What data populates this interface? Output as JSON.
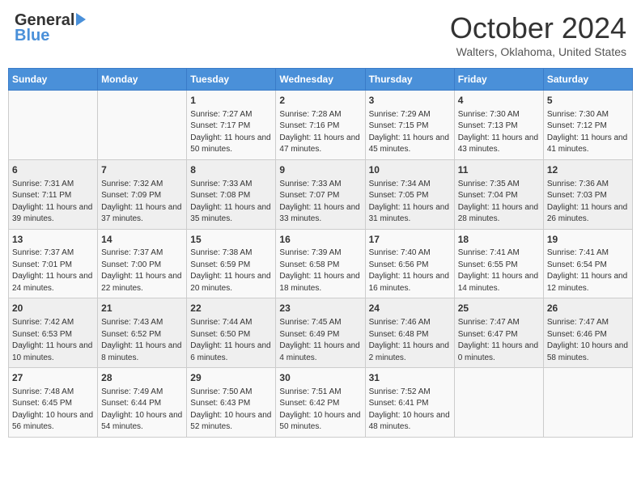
{
  "header": {
    "logo_general": "General",
    "logo_blue": "Blue",
    "month": "October 2024",
    "location": "Walters, Oklahoma, United States"
  },
  "days_of_week": [
    "Sunday",
    "Monday",
    "Tuesday",
    "Wednesday",
    "Thursday",
    "Friday",
    "Saturday"
  ],
  "weeks": [
    [
      {
        "day": "",
        "sunrise": "",
        "sunset": "",
        "daylight": ""
      },
      {
        "day": "",
        "sunrise": "",
        "sunset": "",
        "daylight": ""
      },
      {
        "day": "1",
        "sunrise": "Sunrise: 7:27 AM",
        "sunset": "Sunset: 7:17 PM",
        "daylight": "Daylight: 11 hours and 50 minutes."
      },
      {
        "day": "2",
        "sunrise": "Sunrise: 7:28 AM",
        "sunset": "Sunset: 7:16 PM",
        "daylight": "Daylight: 11 hours and 47 minutes."
      },
      {
        "day": "3",
        "sunrise": "Sunrise: 7:29 AM",
        "sunset": "Sunset: 7:15 PM",
        "daylight": "Daylight: 11 hours and 45 minutes."
      },
      {
        "day": "4",
        "sunrise": "Sunrise: 7:30 AM",
        "sunset": "Sunset: 7:13 PM",
        "daylight": "Daylight: 11 hours and 43 minutes."
      },
      {
        "day": "5",
        "sunrise": "Sunrise: 7:30 AM",
        "sunset": "Sunset: 7:12 PM",
        "daylight": "Daylight: 11 hours and 41 minutes."
      }
    ],
    [
      {
        "day": "6",
        "sunrise": "Sunrise: 7:31 AM",
        "sunset": "Sunset: 7:11 PM",
        "daylight": "Daylight: 11 hours and 39 minutes."
      },
      {
        "day": "7",
        "sunrise": "Sunrise: 7:32 AM",
        "sunset": "Sunset: 7:09 PM",
        "daylight": "Daylight: 11 hours and 37 minutes."
      },
      {
        "day": "8",
        "sunrise": "Sunrise: 7:33 AM",
        "sunset": "Sunset: 7:08 PM",
        "daylight": "Daylight: 11 hours and 35 minutes."
      },
      {
        "day": "9",
        "sunrise": "Sunrise: 7:33 AM",
        "sunset": "Sunset: 7:07 PM",
        "daylight": "Daylight: 11 hours and 33 minutes."
      },
      {
        "day": "10",
        "sunrise": "Sunrise: 7:34 AM",
        "sunset": "Sunset: 7:05 PM",
        "daylight": "Daylight: 11 hours and 31 minutes."
      },
      {
        "day": "11",
        "sunrise": "Sunrise: 7:35 AM",
        "sunset": "Sunset: 7:04 PM",
        "daylight": "Daylight: 11 hours and 28 minutes."
      },
      {
        "day": "12",
        "sunrise": "Sunrise: 7:36 AM",
        "sunset": "Sunset: 7:03 PM",
        "daylight": "Daylight: 11 hours and 26 minutes."
      }
    ],
    [
      {
        "day": "13",
        "sunrise": "Sunrise: 7:37 AM",
        "sunset": "Sunset: 7:01 PM",
        "daylight": "Daylight: 11 hours and 24 minutes."
      },
      {
        "day": "14",
        "sunrise": "Sunrise: 7:37 AM",
        "sunset": "Sunset: 7:00 PM",
        "daylight": "Daylight: 11 hours and 22 minutes."
      },
      {
        "day": "15",
        "sunrise": "Sunrise: 7:38 AM",
        "sunset": "Sunset: 6:59 PM",
        "daylight": "Daylight: 11 hours and 20 minutes."
      },
      {
        "day": "16",
        "sunrise": "Sunrise: 7:39 AM",
        "sunset": "Sunset: 6:58 PM",
        "daylight": "Daylight: 11 hours and 18 minutes."
      },
      {
        "day": "17",
        "sunrise": "Sunrise: 7:40 AM",
        "sunset": "Sunset: 6:56 PM",
        "daylight": "Daylight: 11 hours and 16 minutes."
      },
      {
        "day": "18",
        "sunrise": "Sunrise: 7:41 AM",
        "sunset": "Sunset: 6:55 PM",
        "daylight": "Daylight: 11 hours and 14 minutes."
      },
      {
        "day": "19",
        "sunrise": "Sunrise: 7:41 AM",
        "sunset": "Sunset: 6:54 PM",
        "daylight": "Daylight: 11 hours and 12 minutes."
      }
    ],
    [
      {
        "day": "20",
        "sunrise": "Sunrise: 7:42 AM",
        "sunset": "Sunset: 6:53 PM",
        "daylight": "Daylight: 11 hours and 10 minutes."
      },
      {
        "day": "21",
        "sunrise": "Sunrise: 7:43 AM",
        "sunset": "Sunset: 6:52 PM",
        "daylight": "Daylight: 11 hours and 8 minutes."
      },
      {
        "day": "22",
        "sunrise": "Sunrise: 7:44 AM",
        "sunset": "Sunset: 6:50 PM",
        "daylight": "Daylight: 11 hours and 6 minutes."
      },
      {
        "day": "23",
        "sunrise": "Sunrise: 7:45 AM",
        "sunset": "Sunset: 6:49 PM",
        "daylight": "Daylight: 11 hours and 4 minutes."
      },
      {
        "day": "24",
        "sunrise": "Sunrise: 7:46 AM",
        "sunset": "Sunset: 6:48 PM",
        "daylight": "Daylight: 11 hours and 2 minutes."
      },
      {
        "day": "25",
        "sunrise": "Sunrise: 7:47 AM",
        "sunset": "Sunset: 6:47 PM",
        "daylight": "Daylight: 11 hours and 0 minutes."
      },
      {
        "day": "26",
        "sunrise": "Sunrise: 7:47 AM",
        "sunset": "Sunset: 6:46 PM",
        "daylight": "Daylight: 10 hours and 58 minutes."
      }
    ],
    [
      {
        "day": "27",
        "sunrise": "Sunrise: 7:48 AM",
        "sunset": "Sunset: 6:45 PM",
        "daylight": "Daylight: 10 hours and 56 minutes."
      },
      {
        "day": "28",
        "sunrise": "Sunrise: 7:49 AM",
        "sunset": "Sunset: 6:44 PM",
        "daylight": "Daylight: 10 hours and 54 minutes."
      },
      {
        "day": "29",
        "sunrise": "Sunrise: 7:50 AM",
        "sunset": "Sunset: 6:43 PM",
        "daylight": "Daylight: 10 hours and 52 minutes."
      },
      {
        "day": "30",
        "sunrise": "Sunrise: 7:51 AM",
        "sunset": "Sunset: 6:42 PM",
        "daylight": "Daylight: 10 hours and 50 minutes."
      },
      {
        "day": "31",
        "sunrise": "Sunrise: 7:52 AM",
        "sunset": "Sunset: 6:41 PM",
        "daylight": "Daylight: 10 hours and 48 minutes."
      },
      {
        "day": "",
        "sunrise": "",
        "sunset": "",
        "daylight": ""
      },
      {
        "day": "",
        "sunrise": "",
        "sunset": "",
        "daylight": ""
      }
    ]
  ]
}
